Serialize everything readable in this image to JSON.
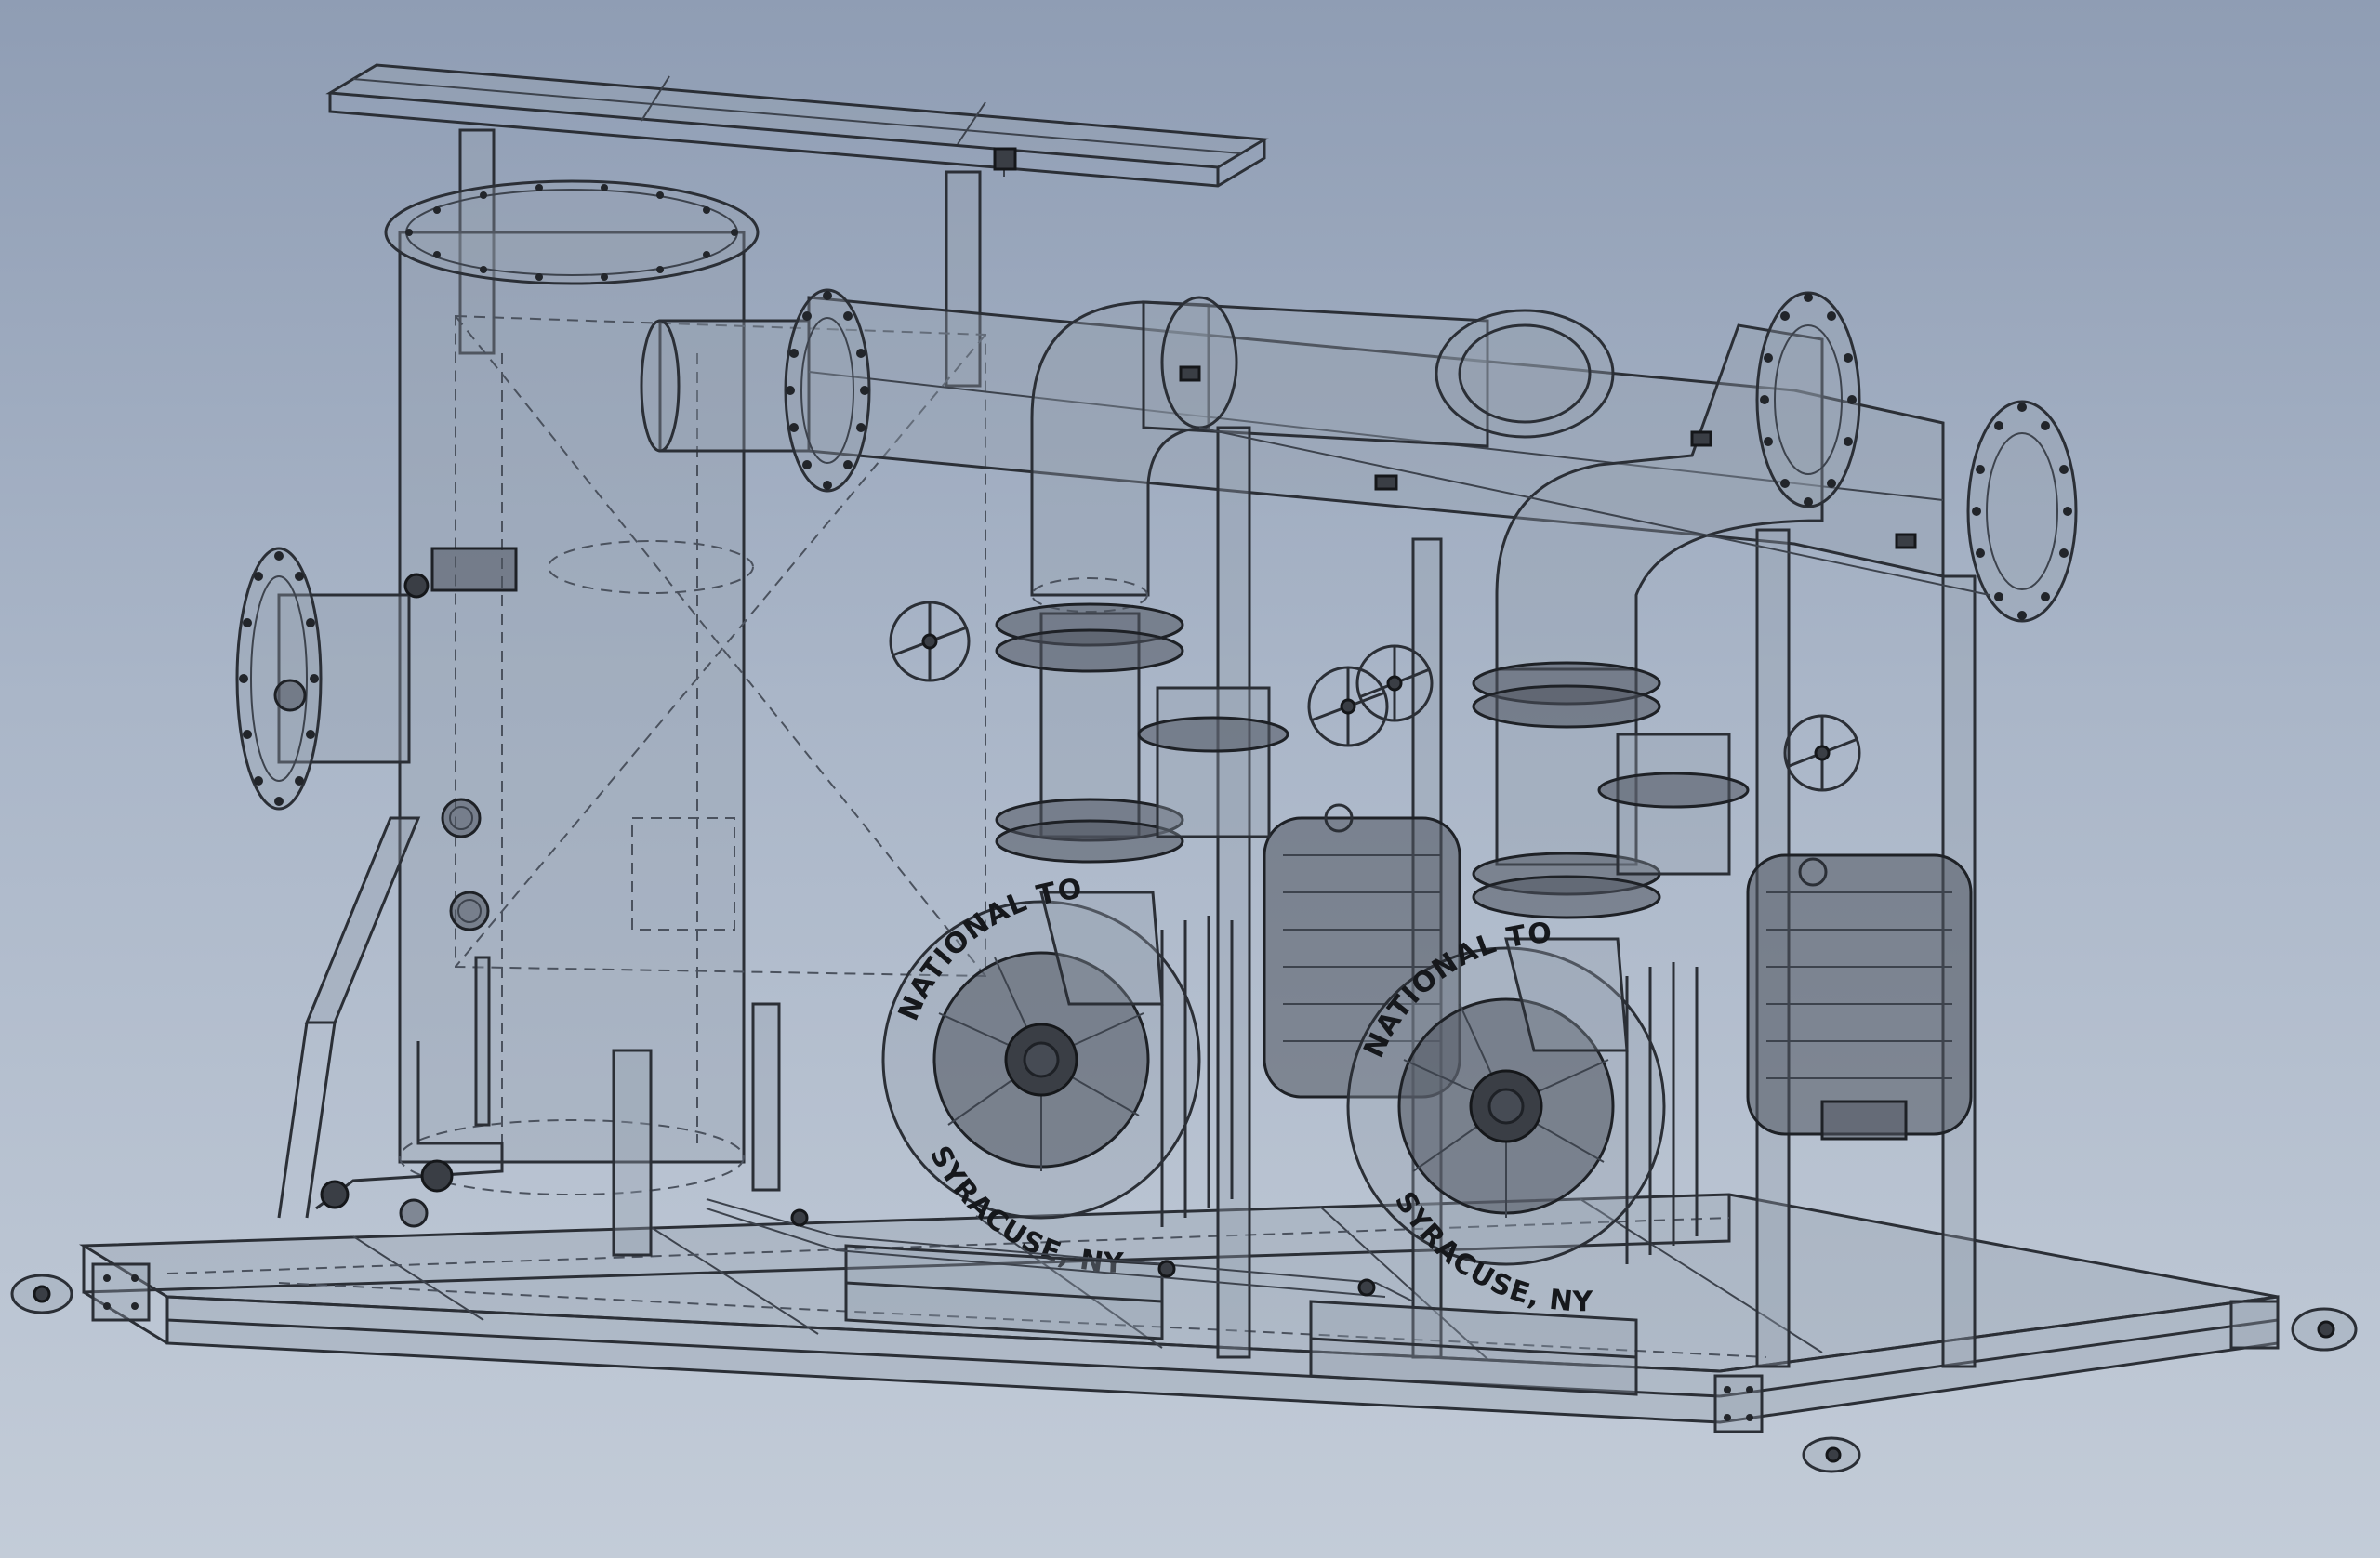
{
  "scene": {
    "pump_a": {
      "top_text": "NATIONAL TO",
      "bottom_text": "SYRACUSE, NY"
    },
    "pump_b": {
      "top_text": "NATIONAL TO",
      "bottom_text": "SYRACUSE, NY"
    }
  },
  "colors": {
    "background_top": "#8f9db4",
    "background_bottom": "#c3ccd8",
    "line": "#2b2f36",
    "metal": "#3a3e45"
  }
}
